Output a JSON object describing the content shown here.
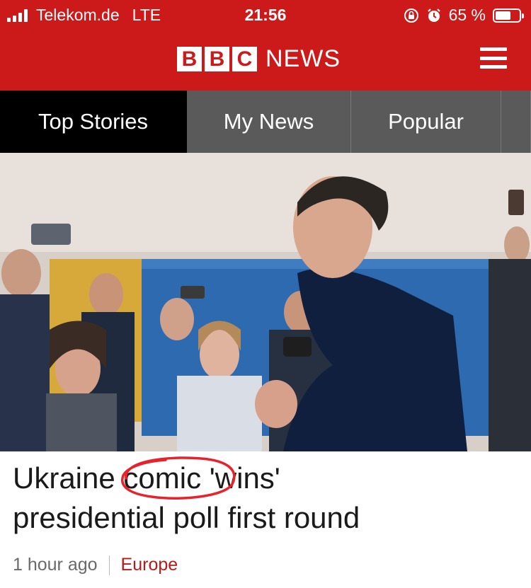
{
  "status_bar": {
    "carrier": "Telekom.de",
    "network": "LTE",
    "time": "21:56",
    "battery": "65 %",
    "battery_level": 0.65,
    "icons": [
      "signal-icon",
      "orientation-lock-icon",
      "alarm-icon",
      "battery-icon"
    ]
  },
  "header": {
    "logo_letters": [
      "B",
      "B",
      "C"
    ],
    "logo_word": "NEWS",
    "menu_icon": "hamburger-menu-icon"
  },
  "tabs": [
    {
      "label": "Top Stories",
      "active": true
    },
    {
      "label": "My News",
      "active": false
    },
    {
      "label": "Popular",
      "active": false
    }
  ],
  "article": {
    "headline_pre": "Ukraine",
    "headline_circled": "comic",
    "headline_post": " 'wins'",
    "headline_line2": "presidential poll first round",
    "age": "1 hour ago",
    "section": "Europe"
  },
  "colors": {
    "brand_red": "#cc1a1a",
    "tab_bar": "#5a5a5a",
    "tab_active": "#000000",
    "section_link": "#bb1919",
    "annotation_circle": "#e8212b"
  }
}
